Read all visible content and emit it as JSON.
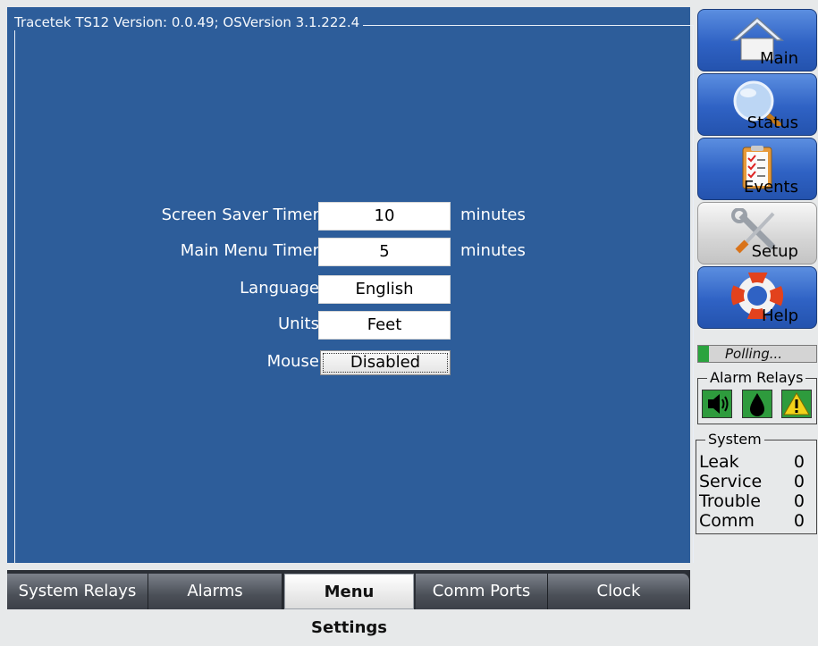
{
  "window": {
    "title": "Tracetek TS12 Version:  0.0.49; OSVersion 3.1.222.4"
  },
  "settings": {
    "screen_saver": {
      "label": "Screen Saver Timer",
      "value": "10",
      "unit": "minutes"
    },
    "main_menu": {
      "label": "Main Menu Timer",
      "value": "5",
      "unit": "minutes"
    },
    "language": {
      "label": "Language",
      "value": "English"
    },
    "units": {
      "label": "Units",
      "value": "Feet"
    },
    "mouse": {
      "label": "Mouse",
      "value": "Disabled"
    }
  },
  "tabs": [
    {
      "label": "System Relays"
    },
    {
      "label": "Alarms"
    },
    {
      "label": "Menu Settings",
      "active": true
    },
    {
      "label": "Comm Ports"
    },
    {
      "label": "Clock"
    }
  ],
  "nav": [
    {
      "label": "Main",
      "icon": "home-icon"
    },
    {
      "label": "Status",
      "icon": "magnifier-icon"
    },
    {
      "label": "Events",
      "icon": "clipboard-icon"
    },
    {
      "label": "Setup",
      "icon": "tools-icon",
      "active": true
    },
    {
      "label": "Help",
      "icon": "lifebuoy-icon"
    }
  ],
  "polling": {
    "text": "Polling..."
  },
  "alarm_relays": {
    "title": "Alarm Relays",
    "icons": [
      "speaker-icon",
      "drop-icon",
      "warning-icon"
    ]
  },
  "system": {
    "title": "System",
    "rows": [
      {
        "label": "Leak",
        "value": "0"
      },
      {
        "label": "Service",
        "value": "0"
      },
      {
        "label": "Trouble",
        "value": "0"
      },
      {
        "label": "Comm",
        "value": "0"
      }
    ]
  },
  "colors": {
    "panel": "#2d5d9a",
    "nav_blue": "#2f62c4",
    "relay_green": "#2e9b3d",
    "warning_yellow": "#f2d21a"
  }
}
